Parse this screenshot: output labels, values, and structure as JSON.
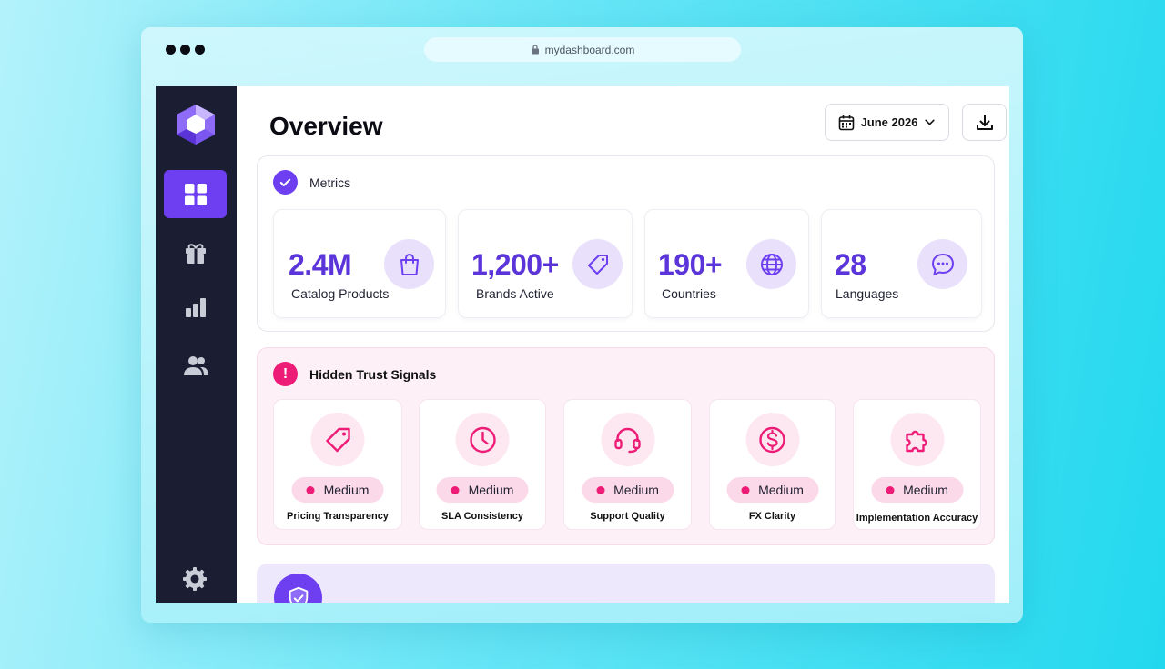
{
  "browser": {
    "url": "mydashboard.com"
  },
  "sidebar": {
    "items": [
      {
        "name": "dashboard",
        "icon": "grid-icon",
        "active": true
      },
      {
        "name": "rewards",
        "icon": "gift-icon",
        "active": false
      },
      {
        "name": "analytics",
        "icon": "bar-chart-icon",
        "active": false
      },
      {
        "name": "users",
        "icon": "users-icon",
        "active": false
      }
    ],
    "settings_icon": "gear-icon"
  },
  "header": {
    "title": "Overview",
    "date_label": "June 2026"
  },
  "metrics": {
    "title": "Metrics",
    "cards": [
      {
        "value": "2.4M",
        "label": "Catalog Products",
        "icon": "shopping-bag-icon"
      },
      {
        "value": "1,200+",
        "label": "Brands Active",
        "icon": "tag-icon"
      },
      {
        "value": "190+",
        "label": "Countries",
        "icon": "globe-icon"
      },
      {
        "value": "28",
        "label": "Languages",
        "icon": "chat-bubble-icon"
      }
    ]
  },
  "trust_signals": {
    "title": "Hidden Trust Signals",
    "cards": [
      {
        "name": "Pricing Transparency",
        "level": "Medium",
        "icon": "price-tag-icon"
      },
      {
        "name": "SLA Consistency",
        "level": "Medium",
        "icon": "clock-icon"
      },
      {
        "name": "Support Quality",
        "level": "Medium",
        "icon": "headset-icon"
      },
      {
        "name": "FX Clarity",
        "level": "Medium",
        "icon": "dollar-circle-icon"
      },
      {
        "name": "Implementation Accuracy",
        "level": "Medium",
        "icon": "puzzle-icon"
      }
    ]
  },
  "colors": {
    "accent": "#6d3ff0",
    "metric_value": "#5b35d9",
    "alert": "#ec1c77",
    "sidebar_bg": "#1b1e33"
  }
}
